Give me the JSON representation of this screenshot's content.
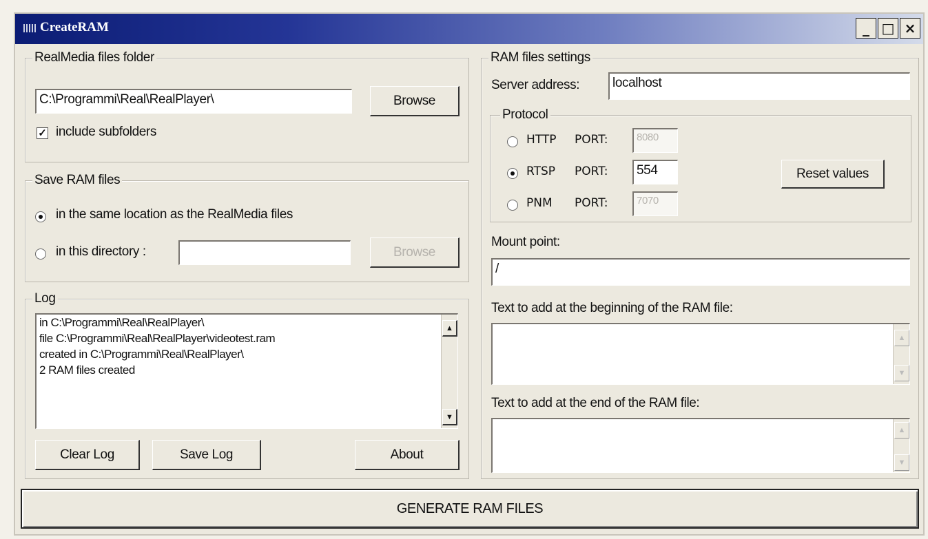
{
  "window": {
    "title": "CreateRAM",
    "controls": [
      "_",
      "□",
      "×"
    ]
  },
  "realmedia_group": {
    "legend": "RealMedia files folder",
    "folder_value": "C:\\Programmi\\Real\\RealPlayer\\",
    "browse_label": "Browse",
    "include_subfolders_label": "include subfolders",
    "include_subfolders_checked": true
  },
  "save_group": {
    "legend": "Save RAM files",
    "option_same_label": "in the same location as the RealMedia files",
    "option_dir_label": "in this directory :",
    "selected": "same",
    "directory_value": "",
    "browse_label": "Browse"
  },
  "log_group": {
    "legend": "Log",
    "lines": [
      "in C:\\Programmi\\Real\\RealPlayer\\",
      "file C:\\Programmi\\Real\\RealPlayer\\videotest.ram",
      "created in C:\\Programmi\\Real\\RealPlayer\\",
      "2 RAM files created"
    ],
    "clear_label": "Clear Log",
    "save_label": "Save Log",
    "about_label": "About"
  },
  "ram_settings": {
    "legend": "RAM files settings",
    "server_label": "Server address:",
    "server_value": "localhost",
    "protocol": {
      "legend": "Protocol",
      "selected": "RTSP",
      "options": [
        {
          "name": "HTTP",
          "port_label": "PORT:",
          "port": "8080"
        },
        {
          "name": "RTSP",
          "port_label": "PORT:",
          "port": "554"
        },
        {
          "name": "PNM",
          "port_label": "PORT:",
          "port": "7070"
        }
      ],
      "reset_label": "Reset values"
    },
    "mount_label": "Mount point:",
    "mount_value": "/",
    "text_begin_label": "Text to add at the beginning of the RAM file:",
    "text_begin_value": "",
    "text_end_label": "Text to add at the end of the RAM file:",
    "text_end_value": ""
  },
  "generate_label": "GENERATE RAM FILES"
}
